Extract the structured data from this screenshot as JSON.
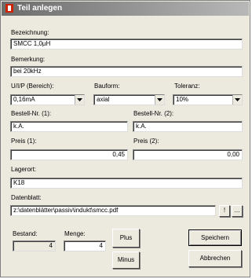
{
  "window": {
    "title": "Teil anlegen"
  },
  "fields": {
    "bezeichnung": {
      "label": "Bezeichnung:",
      "value": "SMCC 1,0µH"
    },
    "bemerkung": {
      "label": "Bemerkung:",
      "value": "bei 20kHz"
    },
    "uip": {
      "label": "U/I/P (Bereich):",
      "value": "0,16mA"
    },
    "bauform": {
      "label": "Bauform:",
      "value": "axial"
    },
    "toleranz": {
      "label": "Toleranz:",
      "value": "10%"
    },
    "bestellnr1": {
      "label": "Bestell-Nr. (1):",
      "value": "k.A."
    },
    "bestellnr2": {
      "label": "Bestell-Nr. (2):",
      "value": "k.A."
    },
    "preis1": {
      "label": "Preis (1):",
      "value": "0,45"
    },
    "preis2": {
      "label": "Preis (2):",
      "value": "0,00"
    },
    "lagerort": {
      "label": "Lagerort:",
      "value": "K18"
    },
    "datenblatt": {
      "label": "Datenblatt:",
      "value": "z:\\datenblätter\\passiv\\indukt\\smcc.pdf"
    }
  },
  "datenblatt_buttons": {
    "open": "!",
    "browse": "..."
  },
  "bestand": {
    "label": "Bestand:",
    "value": "4"
  },
  "menge": {
    "label": "Menge:",
    "value": "4"
  },
  "buttons": {
    "plus": "Plus",
    "minus": "Minus",
    "save": "Speichern",
    "cancel": "Abbrechen"
  },
  "colors": {
    "titlebar_start": "#6c6c6c",
    "titlebar_end": "#b8b8b8",
    "icon": "#cc2200"
  }
}
